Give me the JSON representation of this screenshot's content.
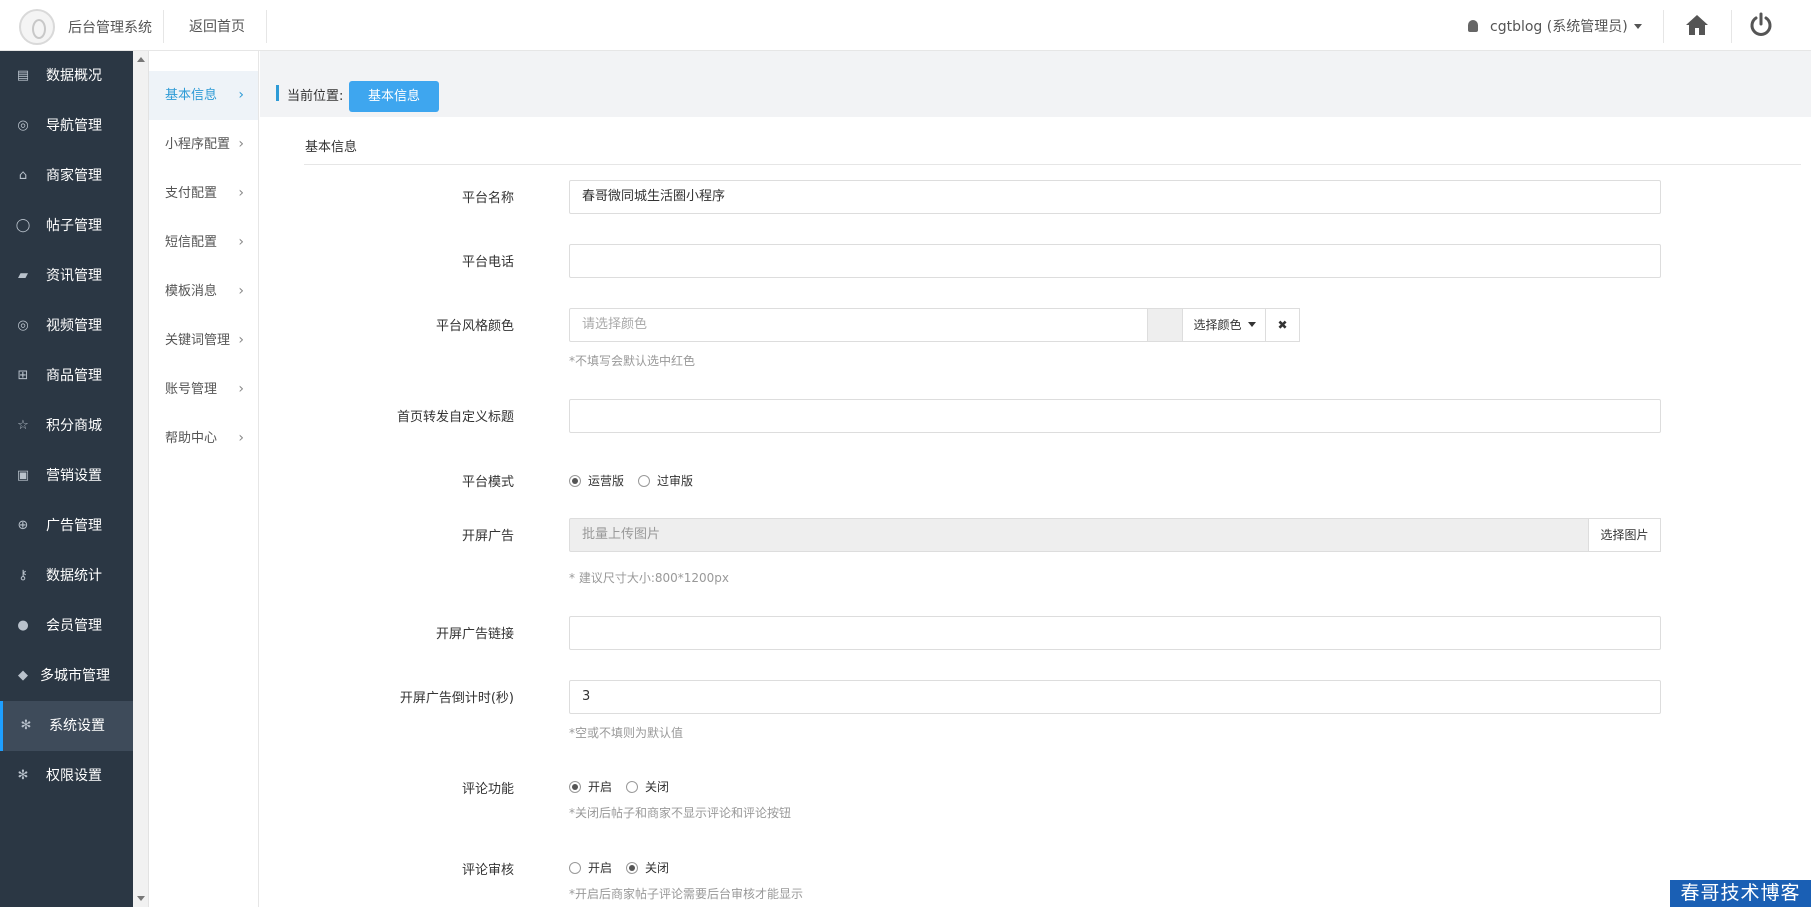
{
  "header": {
    "system_name": "后台管理系统",
    "back_home": "返回首页",
    "user": "cgtblog (系统管理员)"
  },
  "sidebar": {
    "items": [
      {
        "label": "数据概况",
        "icon": "dashboard-icon"
      },
      {
        "label": "导航管理",
        "icon": "compass-icon"
      },
      {
        "label": "商家管理",
        "icon": "bank-icon"
      },
      {
        "label": "帖子管理",
        "icon": "comment-icon"
      },
      {
        "label": "资讯管理",
        "icon": "book-icon"
      },
      {
        "label": "视频管理",
        "icon": "video-icon"
      },
      {
        "label": "商品管理",
        "icon": "cart-icon"
      },
      {
        "label": "积分商城",
        "icon": "star-icon"
      },
      {
        "label": "营销设置",
        "icon": "gift-icon"
      },
      {
        "label": "广告管理",
        "icon": "lifebuoy-icon"
      },
      {
        "label": "数据统计",
        "icon": "key-icon"
      },
      {
        "label": "会员管理",
        "icon": "user-icon"
      },
      {
        "label": "多城市管理",
        "icon": "graduation-cap-icon"
      },
      {
        "label": "系统设置",
        "icon": "gear-icon",
        "active": true
      },
      {
        "label": "权限设置",
        "icon": "gear-icon"
      }
    ]
  },
  "submenu": {
    "items": [
      {
        "label": "基本信息",
        "active": true
      },
      {
        "label": "小程序配置"
      },
      {
        "label": "支付配置"
      },
      {
        "label": "短信配置"
      },
      {
        "label": "模板消息"
      },
      {
        "label": "关键词管理"
      },
      {
        "label": "账号管理"
      },
      {
        "label": "帮助中心"
      }
    ]
  },
  "breadcrumb": {
    "label": "当前位置:",
    "current": "基本信息"
  },
  "panel_title": "基本信息",
  "form": {
    "platform_name": {
      "label": "平台名称",
      "value": "春哥微同城生活圈小程序"
    },
    "platform_phone": {
      "label": "平台电话",
      "value": ""
    },
    "theme_color": {
      "label": "平台风格颜色",
      "placeholder": "请选择颜色",
      "pick_label": "选择颜色",
      "help": "*不填写会默认选中红色"
    },
    "share_title": {
      "label": "首页转发自定义标题",
      "value": ""
    },
    "platform_mode": {
      "label": "平台模式",
      "options": [
        "运营版",
        "过审版"
      ],
      "selected": 0
    },
    "splash_ad": {
      "label": "开屏广告",
      "placeholder": "批量上传图片",
      "button": "选择图片",
      "help": "* 建议尺寸大小:800*1200px"
    },
    "splash_link": {
      "label": "开屏广告链接",
      "value": ""
    },
    "splash_countdown": {
      "label": "开屏广告倒计时(秒)",
      "value": "3",
      "help": "*空或不填则为默认值"
    },
    "comment_feature": {
      "label": "评论功能",
      "options": [
        "开启",
        "关闭"
      ],
      "selected": 0,
      "help": "*关闭后帖子和商家不显示评论和评论按钮"
    },
    "comment_review": {
      "label": "评论审核",
      "options": [
        "开启",
        "关闭"
      ],
      "selected": 1,
      "help": "*开启后商家帖子评论需要后台审核才能显示"
    }
  },
  "watermark": "春哥技术博客",
  "colors": {
    "sidebar_bg": "#2b3744",
    "accent": "#3ea6ef",
    "active_item": "#3e4b5a"
  }
}
